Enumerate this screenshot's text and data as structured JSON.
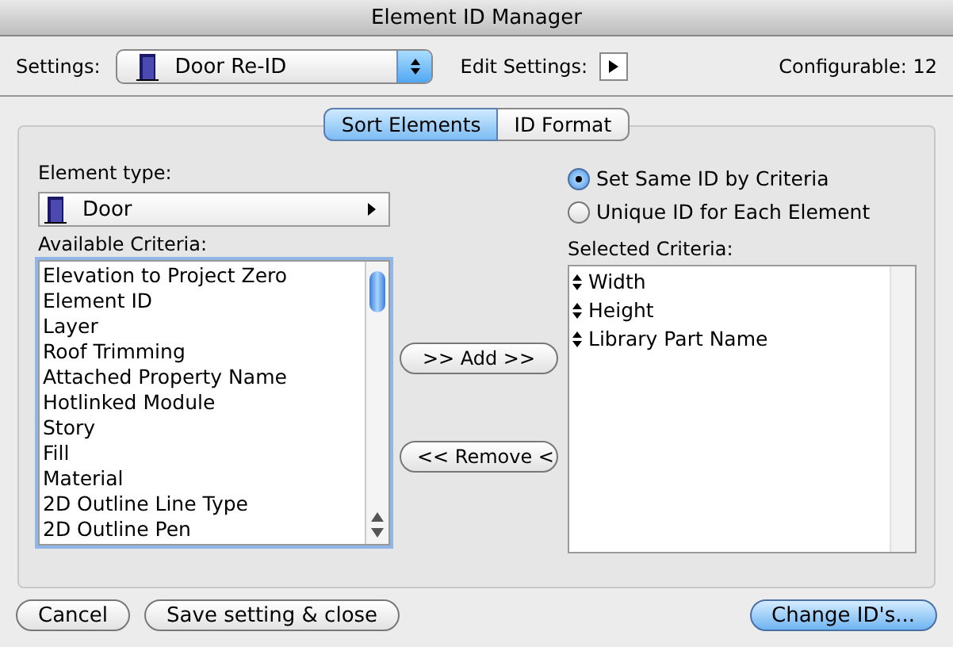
{
  "window": {
    "title": "Element ID Manager"
  },
  "settings": {
    "label": "Settings:",
    "value": "Door Re-ID",
    "edit_label": "Edit Settings:",
    "configurable": "Configurable: 12"
  },
  "tabs": [
    {
      "label": "Sort Elements",
      "selected": true
    },
    {
      "label": "ID Format",
      "selected": false
    }
  ],
  "element_type": {
    "label": "Element type:",
    "value": "Door"
  },
  "available_criteria": {
    "label": "Available Criteria:",
    "items": [
      "Elevation to Project Zero",
      "Element ID",
      "Layer",
      "Roof Trimming",
      "Attached Property Name",
      "Hotlinked Module",
      "Story",
      "Fill",
      "Material",
      "2D Outline Line Type",
      "2D Outline Pen"
    ]
  },
  "add_button": ">> Add >>",
  "remove_button": "<< Remove <",
  "id_mode": [
    {
      "label": "Set Same ID by Criteria",
      "selected": true
    },
    {
      "label": "Unique ID for Each Element",
      "selected": false
    }
  ],
  "selected_criteria": {
    "label": "Selected Criteria:",
    "items": [
      "Width",
      "Height",
      "Library Part Name"
    ]
  },
  "buttons": [
    {
      "label": "Cancel",
      "kind": "normal"
    },
    {
      "label": "Save setting & close",
      "kind": "normal"
    },
    {
      "label": "Change ID's...",
      "kind": "default"
    }
  ]
}
